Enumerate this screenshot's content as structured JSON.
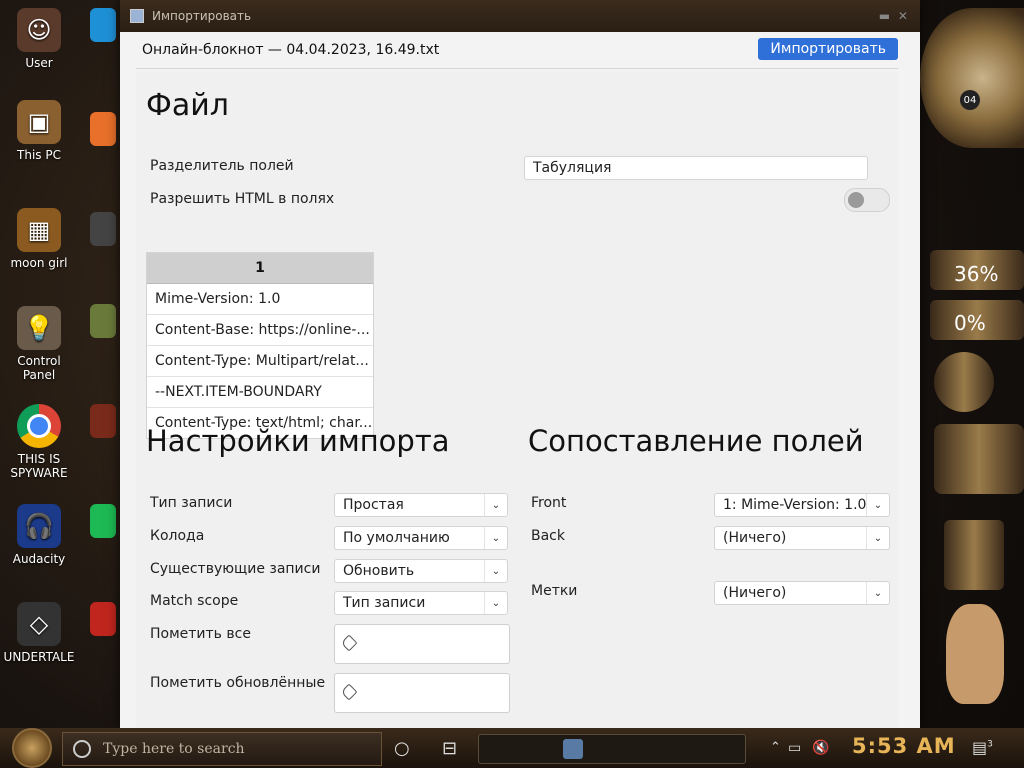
{
  "desktop": {
    "icons": [
      {
        "label": "User"
      },
      {
        "label": "This PC"
      },
      {
        "label": "moon girl"
      },
      {
        "label": "Control Panel"
      },
      {
        "label": "THIS IS SPYWARE"
      },
      {
        "label": "Audacity"
      },
      {
        "label": "UNDERTALE"
      }
    ],
    "gauges": {
      "top": "36%",
      "bottom": "0%"
    },
    "clock_day": "04"
  },
  "window": {
    "title": "Импортировать",
    "file_title": "Онлайн-блокнот — 04.04.2023, 16.49.txt",
    "import_button": "Импортировать"
  },
  "file_section": {
    "heading": "Файл",
    "field_separator_label": "Разделитель полей",
    "field_separator_value": "Табуляция",
    "allow_html_label": "Разрешить HTML в полях",
    "allow_html_enabled": false,
    "preview": {
      "column_header": "1",
      "rows": [
        "Mime-Version: 1.0",
        "Content-Base: https://online-...",
        "Content-Type: Multipart/relat...",
        "--NEXT.ITEM-BOUNDARY",
        "Content-Type: text/html; char..."
      ]
    }
  },
  "import_settings": {
    "heading": "Настройки импорта",
    "note_type_label": "Тип записи",
    "note_type_value": "Простая",
    "deck_label": "Колода",
    "deck_value": "По умолчанию",
    "existing_notes_label": "Существующие записи",
    "existing_notes_value": "Обновить",
    "match_scope_label": "Match scope",
    "match_scope_value": "Тип записи",
    "tag_all_label": "Пометить все",
    "tag_updated_label": "Пометить обновлённые"
  },
  "field_mapping": {
    "heading": "Сопоставление полей",
    "front_label": "Front",
    "front_value": "1: Mime-Version: 1.0",
    "back_label": "Back",
    "back_value": "(Ничего)",
    "tags_label": "Метки",
    "tags_value": "(Ничего)"
  },
  "taskbar": {
    "search_placeholder": "Type here to search",
    "time": "5:53 AM",
    "notification_count": "3"
  },
  "colors": {
    "accent": "#2f6fd8",
    "panel_bg": "#f0f0f0",
    "clock": "#e8b458"
  }
}
